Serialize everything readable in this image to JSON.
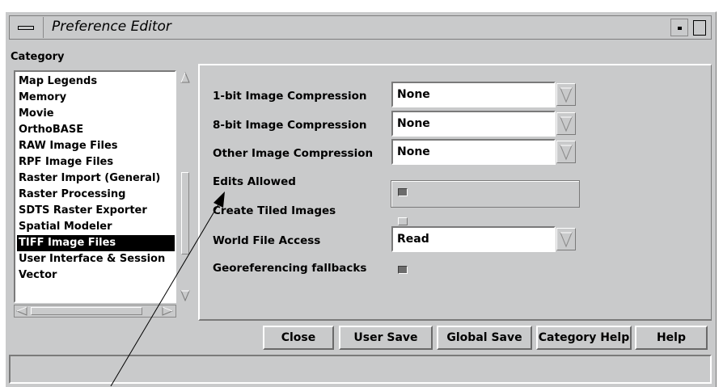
{
  "window": {
    "title": "Preference Editor"
  },
  "category": {
    "label": "Category",
    "items": [
      "Map Legends",
      "Memory",
      "Movie",
      "OrthoBASE",
      "RAW Image Files",
      "RPF Image Files",
      "Raster Import (General)",
      "Raster Processing",
      "SDTS Raster Exporter",
      "Spatial Modeler",
      "TIFF Image Files",
      "User Interface & Session",
      "Vector"
    ],
    "selected": "TIFF Image Files"
  },
  "settings": {
    "compression_1bit": {
      "label": "1-bit Image Compression",
      "value": "None"
    },
    "compression_8bit": {
      "label": "8-bit Image Compression",
      "value": "None"
    },
    "compression_other": {
      "label": "Other Image Compression",
      "value": "None"
    },
    "edits_allowed": {
      "label": "Edits Allowed",
      "checked": true
    },
    "create_tiled": {
      "label": "Create Tiled Images",
      "checked": false
    },
    "world_file_access": {
      "label": "World File Access",
      "value": "Read"
    },
    "georef_fallbacks": {
      "label": "Georeferencing fallbacks",
      "checked": true
    }
  },
  "buttons": {
    "close": "Close",
    "user_save": "User Save",
    "global_save": "Global Save",
    "category_help": "Category Help",
    "help": "Help"
  },
  "icons": {
    "window_menu": "window-menu-icon",
    "minimize": "minimize-icon",
    "maximize": "maximize-icon",
    "dropdown": "triangle-down-icon",
    "scroll_up": "triangle-up-icon",
    "scroll_down": "triangle-down-icon",
    "scroll_left": "triangle-left-icon",
    "scroll_right": "triangle-right-icon"
  }
}
